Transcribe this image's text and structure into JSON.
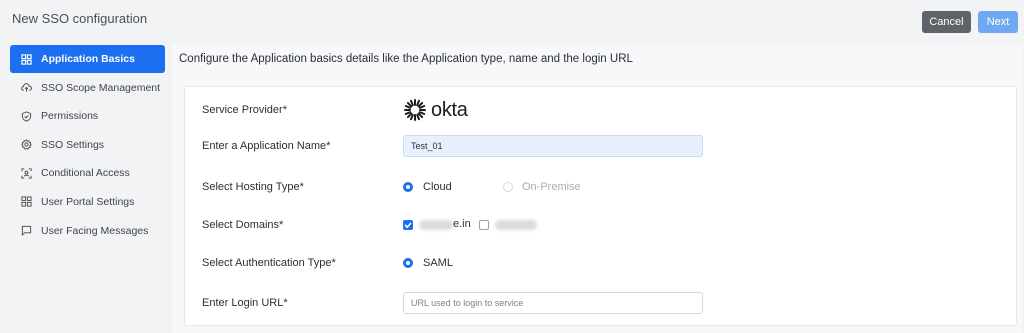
{
  "header": {
    "title": "New SSO configuration",
    "cancel_label": "Cancel",
    "next_label": "Next"
  },
  "sidebar": {
    "items": [
      {
        "label": "Application Basics",
        "icon": "grid-icon",
        "active": true
      },
      {
        "label": "SSO Scope Management",
        "icon": "cloud-upload-icon",
        "active": false
      },
      {
        "label": "Permissions",
        "icon": "shield-icon",
        "active": false
      },
      {
        "label": "SSO Settings",
        "icon": "gear-icon",
        "active": false
      },
      {
        "label": "Conditional Access",
        "icon": "scan-user-icon",
        "active": false
      },
      {
        "label": "User Portal Settings",
        "icon": "grid-icon",
        "active": false
      },
      {
        "label": "User Facing Messages",
        "icon": "message-icon",
        "active": false
      }
    ]
  },
  "main": {
    "description": "Configure the Application basics details like the Application type, name and the login URL",
    "form": {
      "service_provider_label": "Service Provider*",
      "service_provider_name": "okta",
      "app_name_label": "Enter a Application Name*",
      "app_name_value": "Test_01",
      "hosting_label": "Select Hosting Type*",
      "hosting_options": [
        {
          "label": "Cloud",
          "selected": true
        },
        {
          "label": "On-Premise",
          "selected": false
        }
      ],
      "domains_label": "Select Domains*",
      "domains": [
        {
          "label": "e.in",
          "checked": true
        },
        {
          "label": "",
          "checked": false
        }
      ],
      "auth_label": "Select Authentication Type*",
      "auth_option": "SAML",
      "login_url_label": "Enter Login URL*",
      "login_url_placeholder": "URL used to login to service"
    }
  },
  "colors": {
    "accent": "#1b6ff0",
    "cancel": "#5f6369",
    "next": "#6fa8f2"
  }
}
